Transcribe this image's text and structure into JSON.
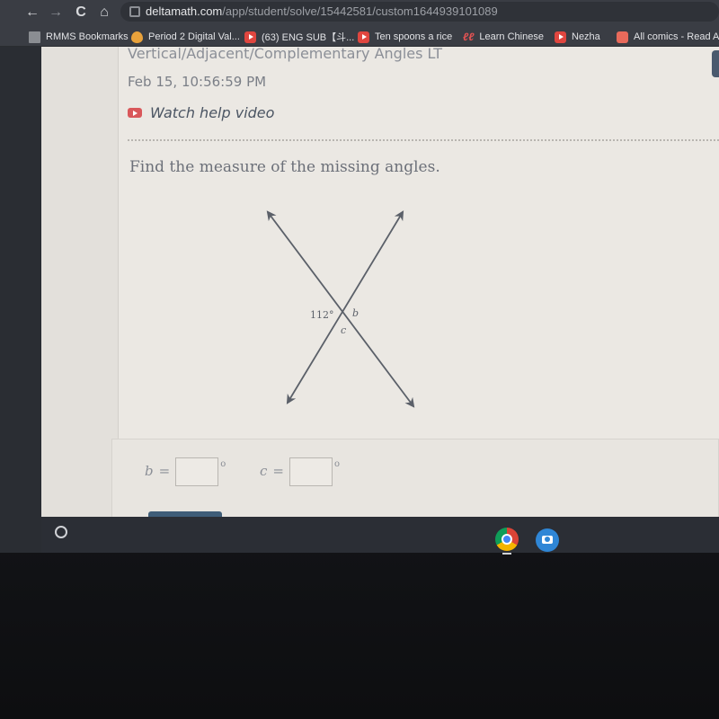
{
  "browser": {
    "url_host": "deltamath.com",
    "url_path": "/app/student/solve/15442581/custom1644939101089",
    "nav": {
      "back": "←",
      "forward": "→",
      "reload": "C",
      "home": "⌂"
    },
    "bookmarks": [
      {
        "label": "RMMS Bookmarks",
        "icon": "folder-icon"
      },
      {
        "label": "Period 2 Digital Val...",
        "icon": "drop-icon"
      },
      {
        "label": "(63) ENG SUB【斗...",
        "icon": "youtube-icon"
      },
      {
        "label": "Ten spoons a rice",
        "icon": "youtube-icon"
      },
      {
        "label": "Learn Chinese",
        "icon": "learn-chinese-icon",
        "glyph": "ℓℓ"
      },
      {
        "label": "Nezha",
        "icon": "youtube-icon"
      },
      {
        "label": "All comics - Read A",
        "icon": "comic-icon"
      }
    ]
  },
  "page": {
    "assignment_title": "Vertical/Adjacent/Complementary Angles LT",
    "timestamp": "Feb 15, 10:56:59 PM",
    "help_link": "Watch help video",
    "question": "Find the measure of the missing angles.",
    "diagram": {
      "given_angle_label": "112°",
      "label_b": "b",
      "label_c": "c"
    },
    "answers": [
      {
        "variable": "b",
        "equals": "=",
        "value": "",
        "unit": "o"
      },
      {
        "variable": "c",
        "equals": "=",
        "value": "",
        "unit": "o"
      }
    ]
  },
  "colors": {
    "accent_button": "#3f5d78",
    "help_icon": "#d9575a",
    "line": "#5b6069"
  }
}
